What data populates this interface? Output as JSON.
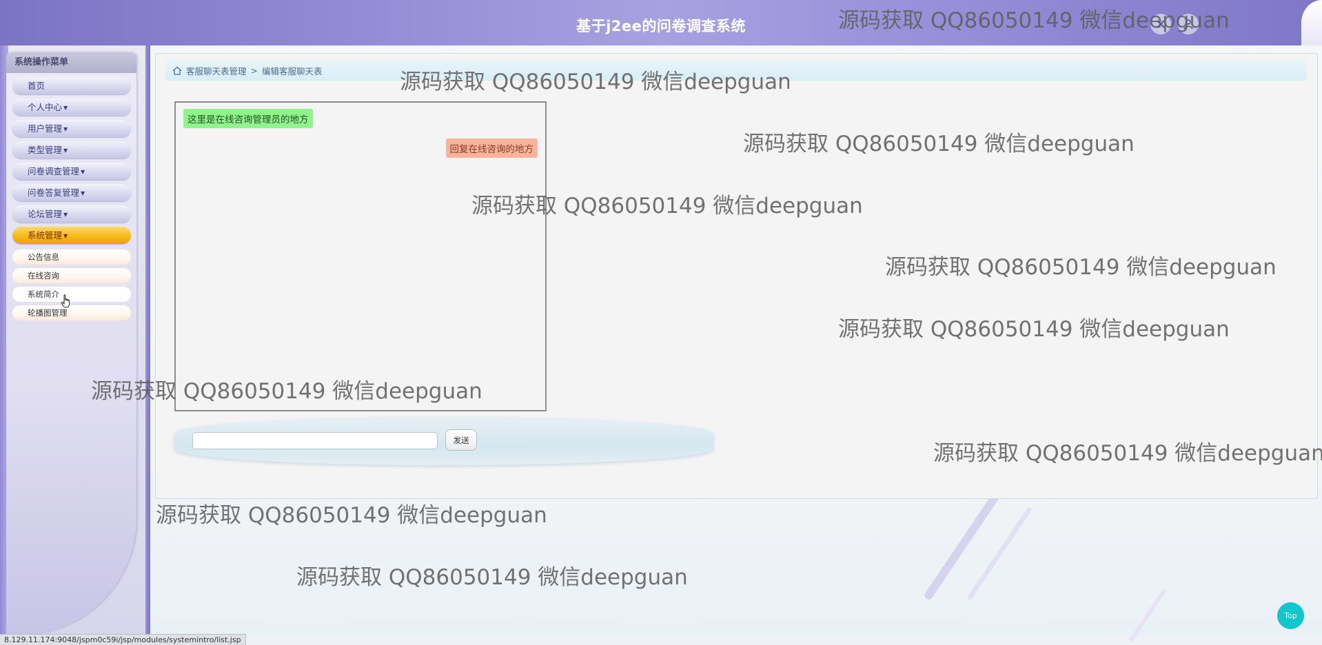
{
  "header": {
    "title": "基于j2ee的问卷调查系统"
  },
  "sidebar": {
    "title": "系统操作菜单",
    "items": [
      {
        "label": "首页",
        "has_caret": false
      },
      {
        "label": "个人中心",
        "has_caret": true
      },
      {
        "label": "用户管理",
        "has_caret": true
      },
      {
        "label": "类型管理",
        "has_caret": true
      },
      {
        "label": "问卷调查管理",
        "has_caret": true
      },
      {
        "label": "问卷答复管理",
        "has_caret": true
      },
      {
        "label": "论坛管理",
        "has_caret": true
      },
      {
        "label": "系统管理",
        "has_caret": true,
        "active": true
      }
    ],
    "sub_items": [
      "公告信息",
      "在线咨询",
      "系统简介",
      "轮播图管理"
    ]
  },
  "breadcrumb": {
    "parent": "客服聊天表管理",
    "separator": ">",
    "current": "编辑客服聊天表"
  },
  "chat": {
    "messages": [
      {
        "role": "admin",
        "text": "这里是在线咨询管理员的地方"
      },
      {
        "role": "reply",
        "text": "回复在线咨询的地方"
      }
    ],
    "input_value": "",
    "send_label": "发送"
  },
  "watermark_text": "源码获取 QQ86050149 微信deepguan",
  "status_url": "8.129.11.174:9048/jspm0c59i/jsp/modules/systemintro/list.jsp",
  "top_button_label": "Top",
  "colors": {
    "header_purple": "#968ed6",
    "active_menu": "#f7b91a",
    "admin_bubble": "#8ff58b",
    "reply_bubble": "#f7b49b",
    "top_button": "#12c7cb"
  },
  "icons": [
    "close-icon",
    "user-icon",
    "home-icon",
    "hand-cursor-icon"
  ]
}
